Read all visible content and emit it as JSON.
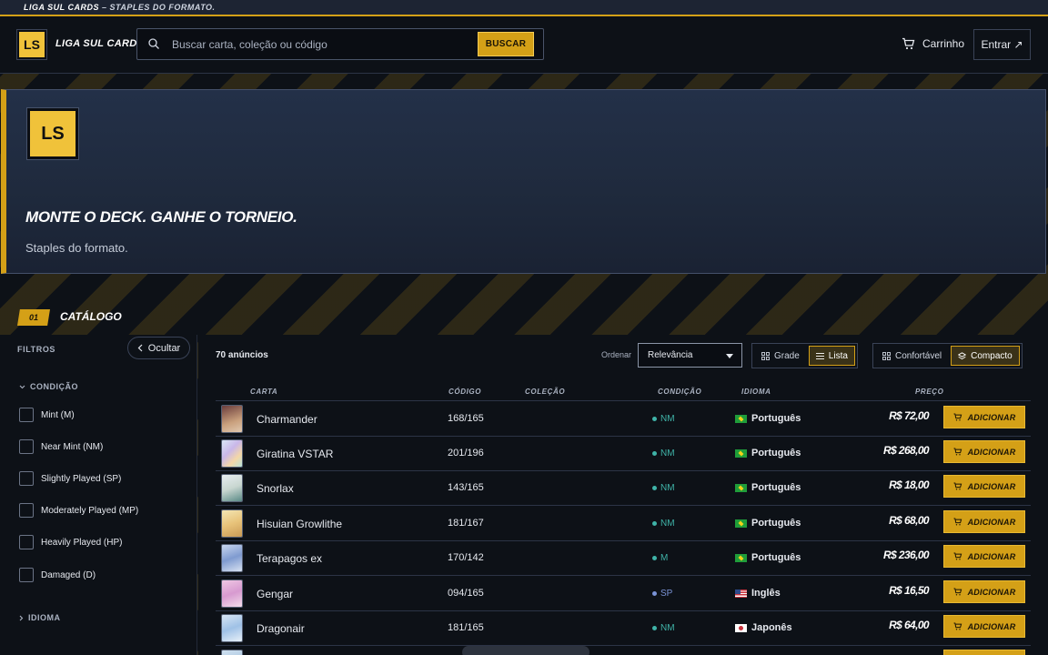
{
  "announcement": {
    "brand": "LIGA SUL CARDS",
    "tagline": " – STAPLES DO FORMATO."
  },
  "header": {
    "logo_text": "LS",
    "brand": "LIGA SUL CARDS",
    "search_placeholder": "Buscar carta, coleção ou código",
    "search_button": "BUSCAR",
    "cart_label": "Carrinho",
    "login_label": "Entrar ↗"
  },
  "hero": {
    "logo_text": "LS",
    "title": "MONTE O DECK. GANHE O TORNEIO.",
    "subtitle": "Staples do formato."
  },
  "section": {
    "number": "01",
    "title": "CATÁLOGO"
  },
  "sidebar": {
    "filters_label": "FILTROS",
    "hide_button": "Ocultar",
    "condition_group": "CONDIÇÃO",
    "conditions": [
      "Mint (M)",
      "Near Mint (NM)",
      "Slightly Played (SP)",
      "Moderately Played (MP)",
      "Heavily Played (HP)",
      "Damaged (D)"
    ],
    "language_group": "IDIOMA"
  },
  "toolbar": {
    "count": "70 anúncios",
    "order_label": "Ordenar",
    "order_value": "Relevância",
    "view_grid": "Grade",
    "view_list": "Lista",
    "density_comfort": "Confortável",
    "density_compact": "Compacto"
  },
  "table": {
    "headers": {
      "card": "CARTA",
      "code": "CÓDIGO",
      "collection": "COLEÇÃO",
      "condition": "CONDIÇÃO",
      "language": "IDIOMA",
      "price": "PREÇO"
    },
    "add_label": "ADICIONAR",
    "rows": [
      {
        "name": "Charmander",
        "code": "168/165",
        "condition": "NM",
        "language": "Português",
        "price": "R$ 72,00"
      },
      {
        "name": "Giratina VSTAR",
        "code": "201/196",
        "condition": "NM",
        "language": "Português",
        "price": "R$ 268,00"
      },
      {
        "name": "Snorlax",
        "code": "143/165",
        "condition": "NM",
        "language": "Português",
        "price": "R$ 18,00"
      },
      {
        "name": "Hisuian Growlithe",
        "code": "181/167",
        "condition": "NM",
        "language": "Português",
        "price": "R$ 68,00"
      },
      {
        "name": "Terapagos ex",
        "code": "170/142",
        "condition": "M",
        "language": "Português",
        "price": "R$ 236,00"
      },
      {
        "name": "Gengar",
        "code": "094/165",
        "condition": "SP",
        "language": "Inglês",
        "price": "R$ 16,50"
      },
      {
        "name": "Dragonair",
        "code": "181/165",
        "condition": "NM",
        "language": "Japonês",
        "price": "R$ 64,00"
      }
    ]
  },
  "colors": {
    "accent": "#d4a017",
    "background": "#0d1117",
    "condition_nm": "#3fb3a8",
    "condition_sp": "#7a93d6"
  }
}
